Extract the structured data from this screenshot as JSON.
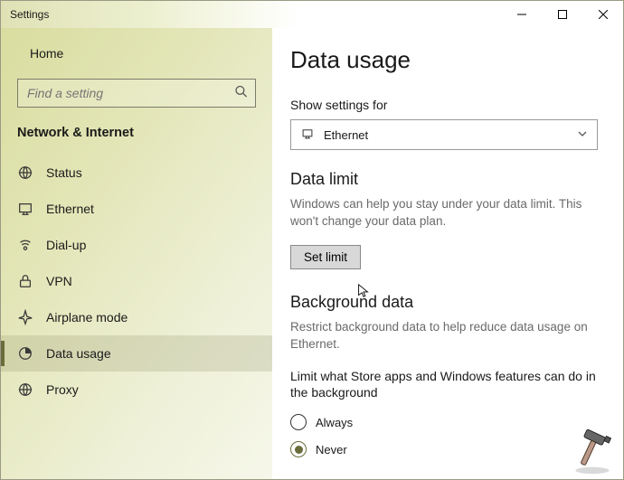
{
  "window": {
    "title": "Settings"
  },
  "sidebar": {
    "home_label": "Home",
    "search_placeholder": "Find a setting",
    "section_header": "Network & Internet",
    "items": [
      {
        "label": "Status"
      },
      {
        "label": "Ethernet"
      },
      {
        "label": "Dial-up"
      },
      {
        "label": "VPN"
      },
      {
        "label": "Airplane mode"
      },
      {
        "label": "Data usage"
      },
      {
        "label": "Proxy"
      }
    ]
  },
  "content": {
    "title": "Data usage",
    "show_settings_label": "Show settings for",
    "dropdown_value": "Ethernet",
    "data_limit": {
      "heading": "Data limit",
      "desc": "Windows can help you stay under your data limit. This won't change your data plan.",
      "button": "Set limit"
    },
    "background": {
      "heading": "Background data",
      "desc": "Restrict background data to help reduce data usage on Ethernet.",
      "label": "Limit what Store apps and Windows features can do in the background",
      "options": [
        {
          "label": "Always",
          "selected": false
        },
        {
          "label": "Never",
          "selected": true
        }
      ]
    }
  }
}
